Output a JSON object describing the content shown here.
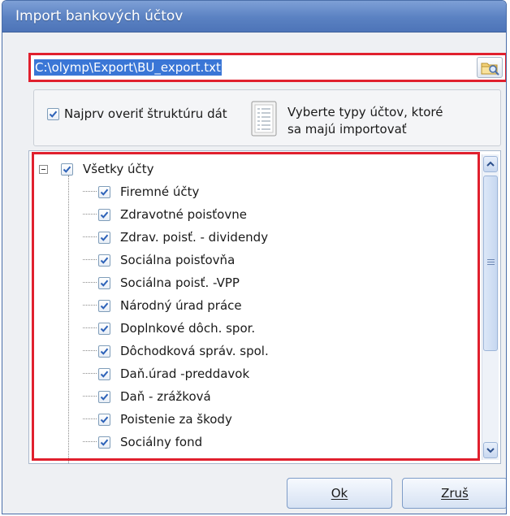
{
  "window": {
    "title": "Import bankových účtov"
  },
  "path": {
    "value": "C:\\olymp\\Export\\BU_export.txt"
  },
  "options": {
    "verify_label": "Najprv overiť štruktúru dát",
    "verify_checked": true,
    "hint_line1": "Vyberte typy účtov, ktoré",
    "hint_line2": "sa majú importovať"
  },
  "tree": {
    "root": {
      "label": "Všetky účty",
      "checked": true
    },
    "items": [
      {
        "label": "Firemné účty",
        "checked": true
      },
      {
        "label": "Zdravotné poisťovne",
        "checked": true
      },
      {
        "label": "Zdrav. poisť. - dividendy",
        "checked": true
      },
      {
        "label": "Sociálna poisťovňa",
        "checked": true
      },
      {
        "label": "Sociálna poisť. -VPP",
        "checked": true
      },
      {
        "label": "Národný úrad práce",
        "checked": true
      },
      {
        "label": "Doplnkové dôch. spor.",
        "checked": true
      },
      {
        "label": "Dôchodková správ. spol.",
        "checked": true
      },
      {
        "label": "Daň.úrad -preddavok",
        "checked": true
      },
      {
        "label": "Daň - zrážková",
        "checked": true
      },
      {
        "label": "Poistenie za škody",
        "checked": true
      },
      {
        "label": "Sociálny fond",
        "checked": true
      }
    ]
  },
  "buttons": {
    "ok": "Ok",
    "cancel": "Zruš"
  },
  "colors": {
    "highlight": "#e0202e",
    "selection": "#3a76d6",
    "titlebar": "#5a81c2"
  }
}
